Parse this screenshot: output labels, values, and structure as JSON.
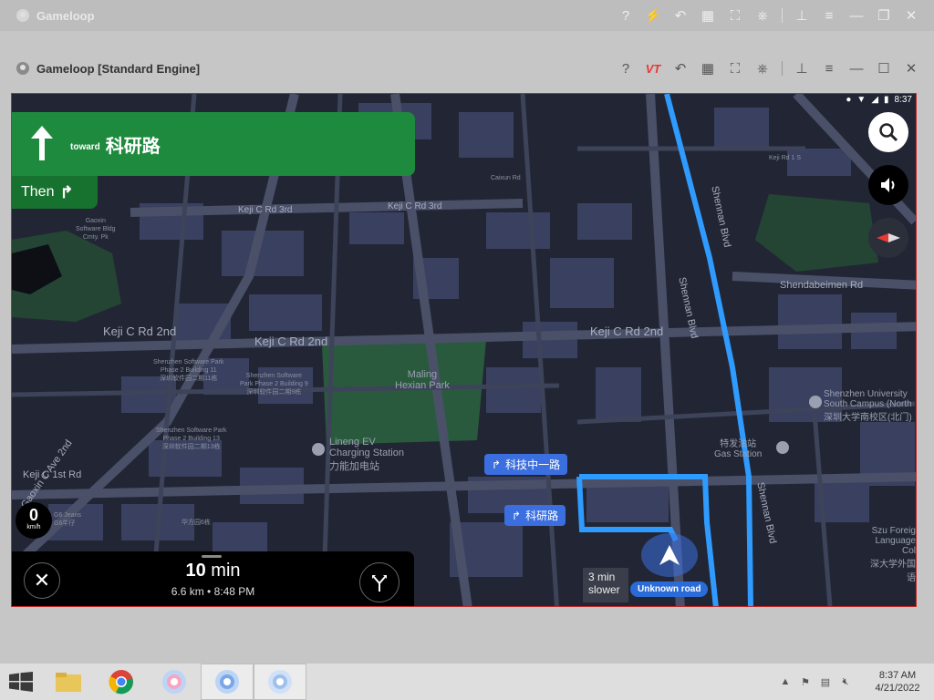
{
  "window_back": {
    "title": "Gameloop"
  },
  "window": {
    "title": "Gameloop [Standard Engine]",
    "vt_label": "VT"
  },
  "status": {
    "time": "8:37"
  },
  "nav": {
    "toward_label": "toward",
    "street": "科研路",
    "then_label": "Then",
    "speed_value": "0",
    "speed_unit": "km/h",
    "eta_time": "10",
    "eta_unit": "min",
    "eta_distance": "6.6 km",
    "eta_separator": "•",
    "eta_arrival": "8:48 PM",
    "chip1": "科技中一路",
    "chip2": "科研路",
    "slower_line1": "3 min",
    "slower_line2": "slower",
    "unknown_road": "Unknown road"
  },
  "map_labels": {
    "keji_c_rd_3rd_a": "Keji C Rd 3rd",
    "keji_c_rd_3rd_b": "Keji C Rd 3rd",
    "keji_c_rd_2nd_a": "Keji C Rd 2nd",
    "keji_c_rd_2nd_b": "Keji C Rd 2nd",
    "keji_c_rd_2nd_c": "Keji C Rd 2nd",
    "keji_c_1st_rd": "Keji C 1st Rd",
    "gaoxin_c_ave_2nd": "Gaoxin C Ave 2nd",
    "shennan_blvd_a": "Shennan Blvd",
    "shennan_blvd_b": "Shennan Blvd",
    "shennan_blvd_c": "Shennan Blvd",
    "shendabeimen_rd": "Shendabeimen Rd",
    "maling_park": "Maling\nHexian Park",
    "lineng": "Lineng EV\nCharging Station\n力能加电站",
    "szu_south": "Shenzhen University\nSouth Campus (North\n深圳大学南校区(北门)",
    "szu_foreign": "Szu Foreig\nLanguage Col\n深大学外国语",
    "gas_station": "特发油站\nGas Station",
    "ssp_11": "Shenzhen Software Park\nPhase 2 Building 11\n深圳软件园二期11栋",
    "ssp_9": "Shenzhen Software\nPark Phase 2 Building 9\n深圳软件园二期9栋",
    "ssp_13": "Shenzhen Software Park\nPhase 2 Building 13\n深圳软件园二期13栋",
    "gaoxin_bldg": "Gaoxin\nSoftware Bldg\nCmty. Pk",
    "g6_jeans": "G6 Jeans\nG6牛仔",
    "keji_rd_1s": "Keji Rd 1 S",
    "caixun_rd": "Caixun Rd",
    "keji_rd_3rd": "Keji C Rd 3rd",
    "building_6": "华方园6栋"
  },
  "taskbar": {
    "clock_time": "8:37 AM",
    "clock_date": "4/21/2022"
  },
  "colors": {
    "turn_green": "#1e8a3e",
    "route_blue": "#2f9bff",
    "chip_blue": "#3b6fe0"
  }
}
